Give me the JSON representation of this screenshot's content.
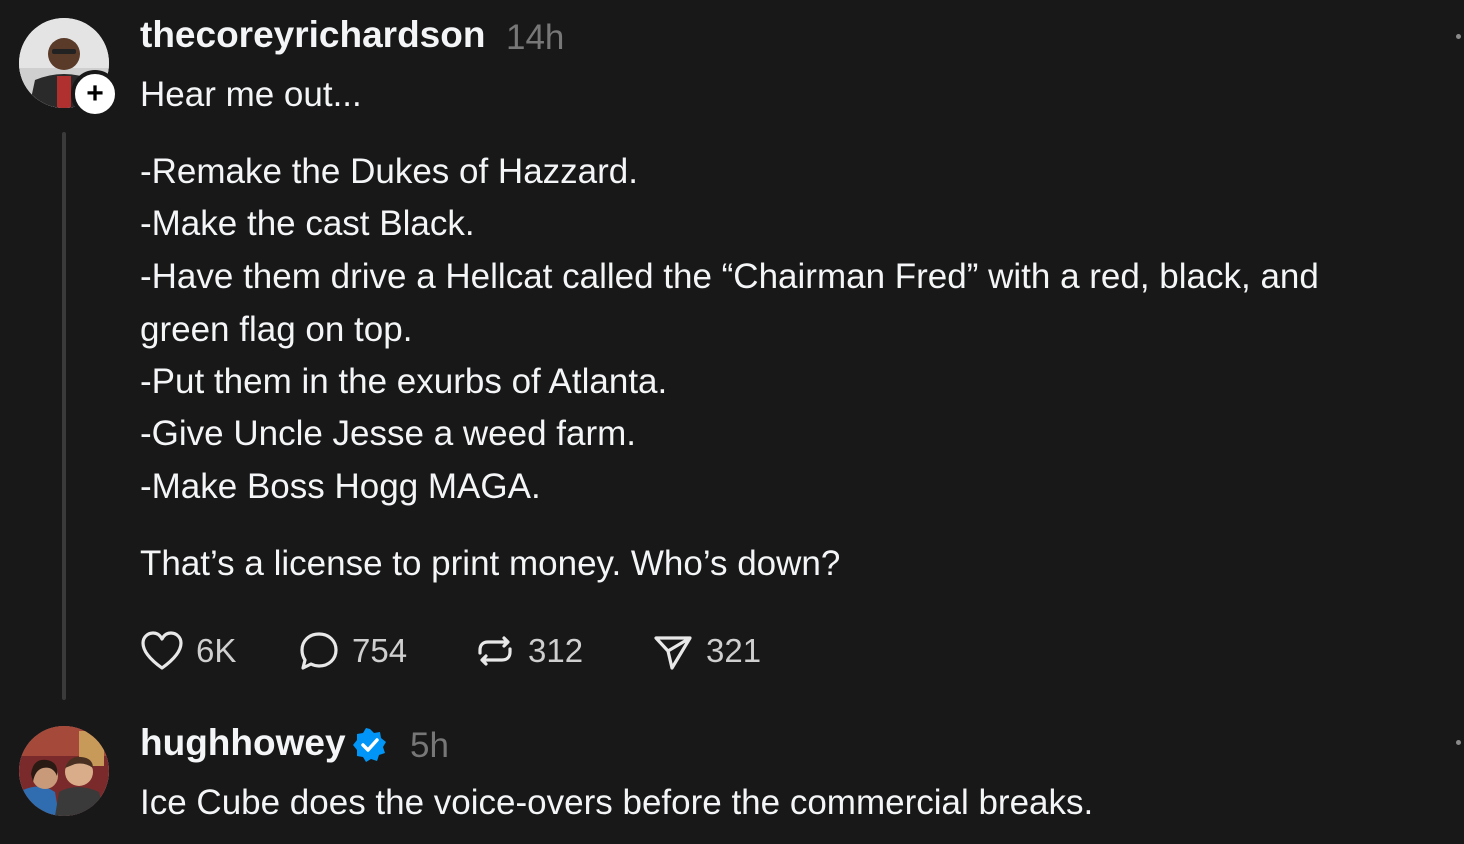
{
  "post1": {
    "username": "thecoreyrichardson",
    "time": "14h",
    "lines": [
      "Hear me out...",
      "-Remake the Dukes of Hazzard.",
      "-Make the cast Black.",
      "-Have them drive a Hellcat called the “Chairman Fred” with a red, black, and",
      "green flag on top.",
      "-Put them in the exurbs of Atlanta.",
      "-Give Uncle Jesse a weed farm.",
      "-Make Boss Hogg MAGA.",
      "That’s a license to print money. Who’s down?"
    ],
    "actions": {
      "likes": "6K",
      "replies": "754",
      "reposts": "312",
      "shares": "321"
    },
    "avatar_icon": "person-avatar",
    "follow_icon": "plus-icon"
  },
  "post2": {
    "username": "hughhowey",
    "time": "5h",
    "text": "Ice Cube does the voice-overs before the commercial breaks.",
    "avatar_icon": "couple-avatar",
    "verified_icon": "verified-badge-icon"
  },
  "colors": {
    "background": "#181818",
    "text": "#f3f5f7",
    "muted": "#777777",
    "verified": "#0095f6"
  }
}
